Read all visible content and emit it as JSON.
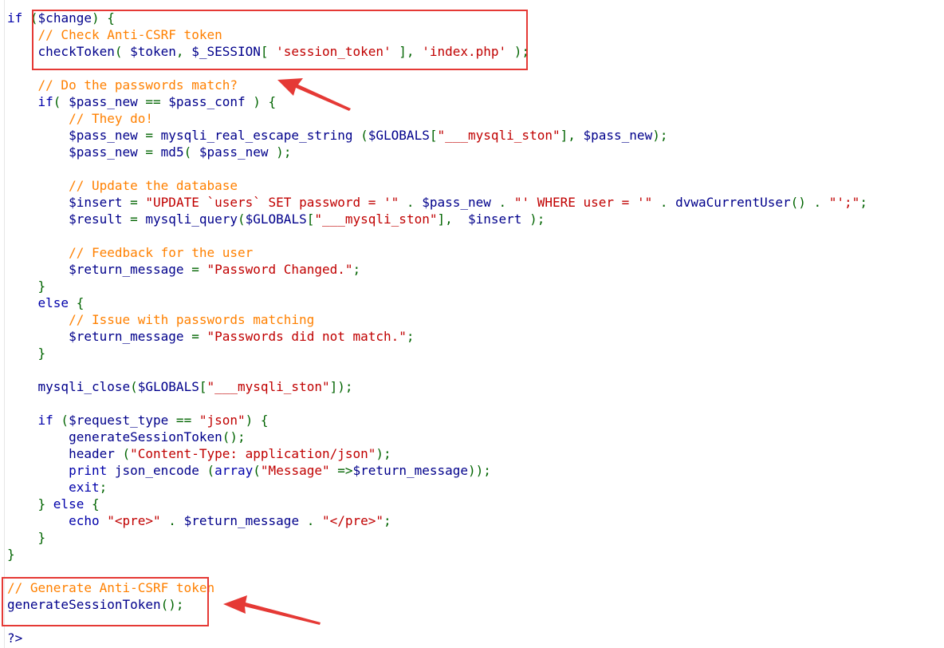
{
  "editor": {
    "code_lines": [
      [
        {
          "t": "if ",
          "c": "keyword"
        },
        {
          "t": "(",
          "c": "punct"
        },
        {
          "t": "$change",
          "c": "var"
        },
        {
          "t": ") {",
          "c": "punct"
        }
      ],
      [
        {
          "t": "    // Check Anti-CSRF token",
          "c": "comment"
        }
      ],
      [
        {
          "t": "    checkToken",
          "c": "func"
        },
        {
          "t": "( ",
          "c": "punct"
        },
        {
          "t": "$token",
          "c": "var"
        },
        {
          "t": ", ",
          "c": "punct"
        },
        {
          "t": "$_SESSION",
          "c": "var"
        },
        {
          "t": "[ ",
          "c": "punct"
        },
        {
          "t": "'session_token'",
          "c": "string"
        },
        {
          "t": " ], ",
          "c": "punct"
        },
        {
          "t": "'index.php'",
          "c": "string"
        },
        {
          "t": " );",
          "c": "punct"
        }
      ],
      [],
      [
        {
          "t": "    // Do the passwords match?",
          "c": "comment"
        }
      ],
      [
        {
          "t": "    if",
          "c": "keyword"
        },
        {
          "t": "( ",
          "c": "punct"
        },
        {
          "t": "$pass_new",
          "c": "var"
        },
        {
          "t": " == ",
          "c": "punct"
        },
        {
          "t": "$pass_conf",
          "c": "var"
        },
        {
          "t": " ) {",
          "c": "punct"
        }
      ],
      [
        {
          "t": "        // They do!",
          "c": "comment"
        }
      ],
      [
        {
          "t": "        $pass_new",
          "c": "var"
        },
        {
          "t": " = ",
          "c": "punct"
        },
        {
          "t": "mysqli_real_escape_string",
          "c": "func"
        },
        {
          "t": " (",
          "c": "punct"
        },
        {
          "t": "$GLOBALS",
          "c": "var"
        },
        {
          "t": "[",
          "c": "punct"
        },
        {
          "t": "\"___mysqli_ston\"",
          "c": "string"
        },
        {
          "t": "], ",
          "c": "punct"
        },
        {
          "t": "$pass_new",
          "c": "var"
        },
        {
          "t": ");",
          "c": "punct"
        }
      ],
      [
        {
          "t": "        $pass_new",
          "c": "var"
        },
        {
          "t": " = ",
          "c": "punct"
        },
        {
          "t": "md5",
          "c": "func"
        },
        {
          "t": "( ",
          "c": "punct"
        },
        {
          "t": "$pass_new",
          "c": "var"
        },
        {
          "t": " );",
          "c": "punct"
        }
      ],
      [],
      [
        {
          "t": "        // Update the database",
          "c": "comment"
        }
      ],
      [
        {
          "t": "        $insert",
          "c": "var"
        },
        {
          "t": " = ",
          "c": "punct"
        },
        {
          "t": "\"UPDATE `users` SET password = '\"",
          "c": "string"
        },
        {
          "t": " . ",
          "c": "punct"
        },
        {
          "t": "$pass_new",
          "c": "var"
        },
        {
          "t": " . ",
          "c": "punct"
        },
        {
          "t": "\"' WHERE user = '\"",
          "c": "string"
        },
        {
          "t": " . ",
          "c": "punct"
        },
        {
          "t": "dvwaCurrentUser",
          "c": "func"
        },
        {
          "t": "() . ",
          "c": "punct"
        },
        {
          "t": "\"';\"",
          "c": "string"
        },
        {
          "t": ";",
          "c": "punct"
        }
      ],
      [
        {
          "t": "        $result",
          "c": "var"
        },
        {
          "t": " = ",
          "c": "punct"
        },
        {
          "t": "mysqli_query",
          "c": "func"
        },
        {
          "t": "(",
          "c": "punct"
        },
        {
          "t": "$GLOBALS",
          "c": "var"
        },
        {
          "t": "[",
          "c": "punct"
        },
        {
          "t": "\"___mysqli_ston\"",
          "c": "string"
        },
        {
          "t": "],  ",
          "c": "punct"
        },
        {
          "t": "$insert",
          "c": "var"
        },
        {
          "t": " );",
          "c": "punct"
        }
      ],
      [],
      [
        {
          "t": "        // Feedback for the user",
          "c": "comment"
        }
      ],
      [
        {
          "t": "        $return_message",
          "c": "var"
        },
        {
          "t": " = ",
          "c": "punct"
        },
        {
          "t": "\"Password Changed.\"",
          "c": "string"
        },
        {
          "t": ";",
          "c": "punct"
        }
      ],
      [
        {
          "t": "    }",
          "c": "punct"
        }
      ],
      [
        {
          "t": "    else",
          "c": "keyword"
        },
        {
          "t": " {",
          "c": "punct"
        }
      ],
      [
        {
          "t": "        // Issue with passwords matching",
          "c": "comment"
        }
      ],
      [
        {
          "t": "        $return_message",
          "c": "var"
        },
        {
          "t": " = ",
          "c": "punct"
        },
        {
          "t": "\"Passwords did not match.\"",
          "c": "string"
        },
        {
          "t": ";",
          "c": "punct"
        }
      ],
      [
        {
          "t": "    }",
          "c": "punct"
        }
      ],
      [],
      [
        {
          "t": "    mysqli_close",
          "c": "func"
        },
        {
          "t": "(",
          "c": "punct"
        },
        {
          "t": "$GLOBALS",
          "c": "var"
        },
        {
          "t": "[",
          "c": "punct"
        },
        {
          "t": "\"___mysqli_ston\"",
          "c": "string"
        },
        {
          "t": "]);",
          "c": "punct"
        }
      ],
      [],
      [
        {
          "t": "    if",
          "c": "keyword"
        },
        {
          "t": " (",
          "c": "punct"
        },
        {
          "t": "$request_type",
          "c": "var"
        },
        {
          "t": " == ",
          "c": "punct"
        },
        {
          "t": "\"json\"",
          "c": "string"
        },
        {
          "t": ") {",
          "c": "punct"
        }
      ],
      [
        {
          "t": "        generateSessionToken",
          "c": "func"
        },
        {
          "t": "();",
          "c": "punct"
        }
      ],
      [
        {
          "t": "        header",
          "c": "func"
        },
        {
          "t": " (",
          "c": "punct"
        },
        {
          "t": "\"Content-Type: application/json\"",
          "c": "string"
        },
        {
          "t": ");",
          "c": "punct"
        }
      ],
      [
        {
          "t": "        print",
          "c": "keyword"
        },
        {
          "t": " ",
          "c": "plain"
        },
        {
          "t": "json_encode",
          "c": "func"
        },
        {
          "t": " (",
          "c": "punct"
        },
        {
          "t": "array",
          "c": "keyword"
        },
        {
          "t": "(",
          "c": "punct"
        },
        {
          "t": "\"Message\"",
          "c": "string"
        },
        {
          "t": " =>",
          "c": "punct"
        },
        {
          "t": "$return_message",
          "c": "var"
        },
        {
          "t": "));",
          "c": "punct"
        }
      ],
      [
        {
          "t": "        exit",
          "c": "keyword"
        },
        {
          "t": ";",
          "c": "punct"
        }
      ],
      [
        {
          "t": "    } ",
          "c": "punct"
        },
        {
          "t": "else",
          "c": "keyword"
        },
        {
          "t": " {",
          "c": "punct"
        }
      ],
      [
        {
          "t": "        echo",
          "c": "keyword"
        },
        {
          "t": " ",
          "c": "plain"
        },
        {
          "t": "\"<pre>\"",
          "c": "string"
        },
        {
          "t": " . ",
          "c": "punct"
        },
        {
          "t": "$return_message",
          "c": "var"
        },
        {
          "t": " . ",
          "c": "punct"
        },
        {
          "t": "\"</pre>\"",
          "c": "string"
        },
        {
          "t": ";",
          "c": "punct"
        }
      ],
      [
        {
          "t": "    }",
          "c": "punct"
        }
      ],
      [
        {
          "t": "}",
          "c": "punct"
        }
      ],
      [],
      [
        {
          "t": "// Generate Anti-CSRF token",
          "c": "comment"
        }
      ],
      [
        {
          "t": "generateSessionToken",
          "c": "func"
        },
        {
          "t": "();",
          "c": "punct"
        }
      ],
      [],
      [
        {
          "t": "?>",
          "c": "var"
        }
      ]
    ]
  },
  "annotations": {
    "color": "#e53935",
    "boxes": [
      "csrf-check-box",
      "generate-token-box"
    ],
    "arrows": [
      "arrow-to-csrf-check",
      "arrow-to-generate-token"
    ]
  }
}
